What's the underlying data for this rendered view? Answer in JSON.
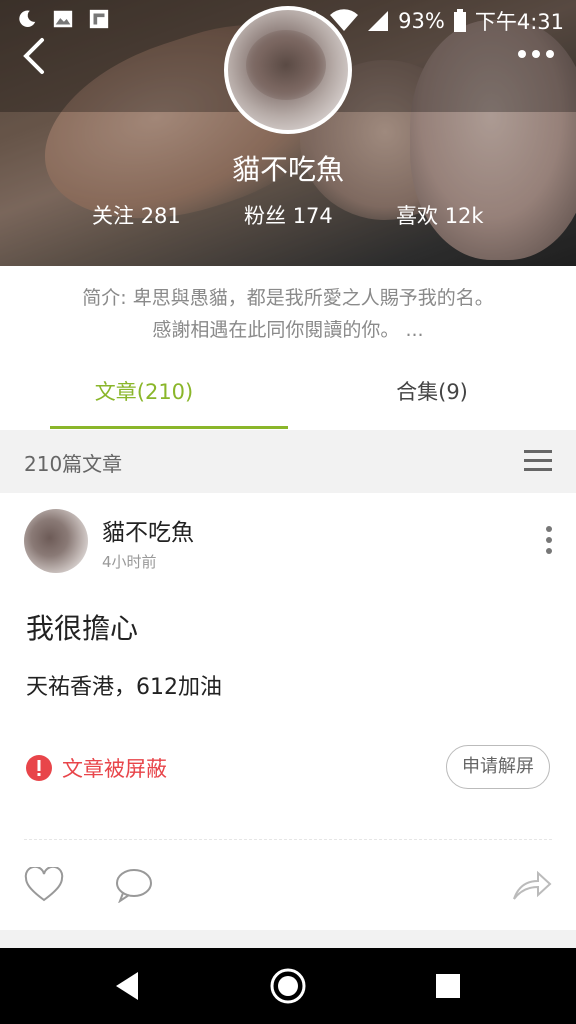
{
  "status_bar": {
    "battery": "93%",
    "time": "下午4:31"
  },
  "profile": {
    "name": "貓不吃魚",
    "stats": [
      {
        "label": "关注",
        "value": "281"
      },
      {
        "label": "粉丝",
        "value": "174"
      },
      {
        "label": "喜欢",
        "value": "12k"
      }
    ],
    "intro_line1": "简介: 卑思與愚貓，都是我所愛之人賜予我的名。",
    "intro_line2": "感謝相遇在此同你閱讀的你。 ..."
  },
  "tabs": [
    {
      "label": "文章(210)",
      "active": true
    },
    {
      "label": "合集(9)",
      "active": false
    }
  ],
  "section": {
    "count_label": "210篇文章"
  },
  "post": {
    "author": "貓不吃魚",
    "time": "4小时前",
    "title": "我很擔心",
    "body": "天祐香港，612加油",
    "blocked_text": "文章被屏蔽",
    "unblock_label": "申请解屏"
  },
  "colors": {
    "accent": "#8ab62a",
    "alert": "#e8454a"
  },
  "icons": [
    "moon-icon",
    "image-icon",
    "flipboard-icon",
    "alarm-icon",
    "data-icon",
    "wifi-icon",
    "signal-icon",
    "battery-icon",
    "back-icon",
    "more-icon",
    "menu-icon",
    "kebab-icon",
    "alert-icon",
    "heart-icon",
    "comment-icon",
    "share-icon",
    "nav-back-icon",
    "nav-home-icon",
    "nav-recent-icon"
  ]
}
